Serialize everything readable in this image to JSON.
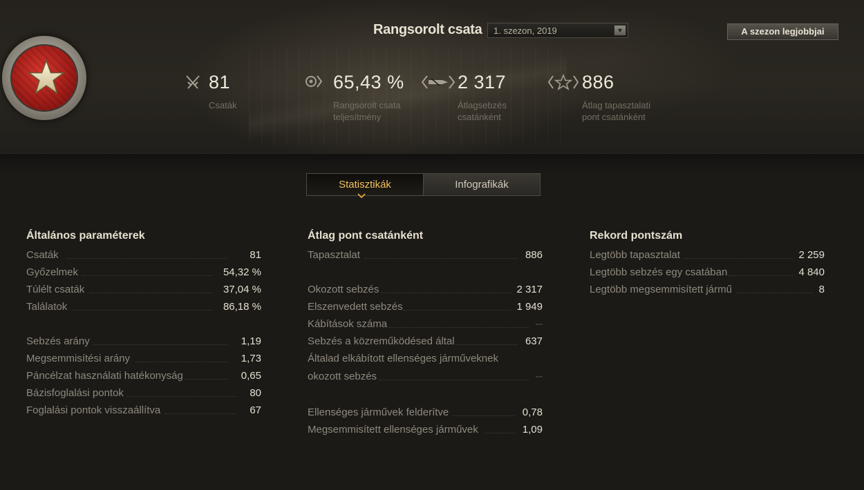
{
  "header": {
    "title": "Rangsorolt csata",
    "season_select": {
      "value": "1. szezon, 2019"
    },
    "best_button": "A szezon legjobbjai"
  },
  "summary": [
    {
      "icon": "crossed-swords-icon",
      "value": "81",
      "label_lines": [
        "Csaták"
      ]
    },
    {
      "icon": "rank-chevron-icon",
      "value": "65,43 %",
      "label_lines": [
        "Rangsorolt csata",
        "teljesítmény"
      ]
    },
    {
      "icon": "damage-shell-icon",
      "value": "2 317",
      "label_lines": [
        "Átlagsebzés",
        "csatánként"
      ]
    },
    {
      "icon": "experience-star-icon",
      "value": "886",
      "label_lines": [
        "Átlag tapasztalati",
        "pont csatánként"
      ]
    }
  ],
  "tabs": [
    {
      "label": "Statisztikák",
      "active": true
    },
    {
      "label": "Infografikák",
      "active": false
    }
  ],
  "columns": {
    "general": {
      "title": "Általános paraméterek",
      "rows": [
        {
          "label": "Csaták",
          "value": "81"
        },
        {
          "label": "Győzelmek",
          "value": "54,32 %"
        },
        {
          "label": "Túlélt csaták",
          "value": "37,04 %"
        },
        {
          "label": "Találatok",
          "value": "86,18 %"
        },
        {
          "label": "Sebzés arány",
          "value": "1,19"
        },
        {
          "label": "Megsemmisítési arány",
          "value": "1,73"
        },
        {
          "label": "Páncélzat használati hatékonyság",
          "value": "0,65"
        },
        {
          "label": "Bázisfoglalási pontok",
          "value": "80"
        },
        {
          "label": "Foglalási pontok visszaállítva",
          "value": "67"
        }
      ]
    },
    "average": {
      "title": "Átlag pont csatánként",
      "rows": [
        {
          "label": "Tapasztalat",
          "value": "886"
        },
        {
          "label": "Okozott sebzés",
          "value": "2 317"
        },
        {
          "label": "Elszenvedett sebzés",
          "value": "1 949"
        },
        {
          "label": "Kábítások száma",
          "value": "--"
        },
        {
          "label": "Sebzés a közreműködésed által",
          "value": "637"
        },
        {
          "label": "Általad elkábított ellenséges járműveknek",
          "value": ""
        },
        {
          "label": "okozott sebzés",
          "value": "--"
        },
        {
          "label": "Ellenséges járművek felderítve",
          "value": "0,78"
        },
        {
          "label": "Megsemmisített ellenséges járművek",
          "value": "1,09"
        }
      ]
    },
    "record": {
      "title": "Rekord pontszám",
      "rows": [
        {
          "label": "Legtöbb tapasztalat",
          "value": "2 259"
        },
        {
          "label": "Legtöbb sebzés egy csatában",
          "value": "4 840"
        },
        {
          "label": "Legtöbb megsemmisített jármű",
          "value": "8"
        }
      ]
    }
  },
  "colors": {
    "accent_tab": "#f2c25a",
    "value_text": "#e4dfd0",
    "label_text": "#8e897e",
    "medal_red": "#a11d18"
  }
}
